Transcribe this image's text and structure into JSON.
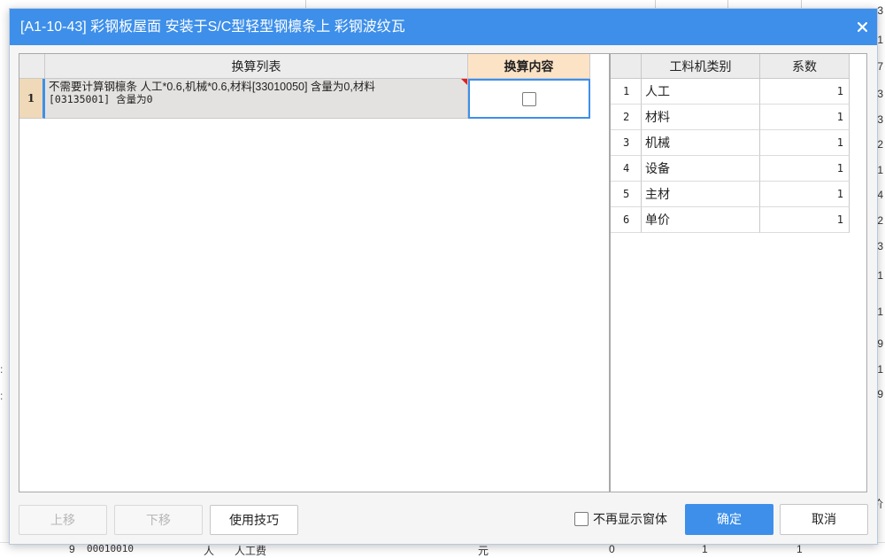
{
  "dialog": {
    "title": "[A1-10-43] 彩钢板屋面 安装于S/C型轻型钢檩条上 彩钢波纹瓦",
    "close_icon": "close-icon"
  },
  "left_table": {
    "headers": {
      "list": "换算列表",
      "content": "换算内容"
    },
    "rows": [
      {
        "num": "1",
        "text_line1": "不需要计算钢檩条 人工*0.6,机械*0.6,材料[33010050] 含量为0,材料",
        "text_line2": "[03135001] 含量为0",
        "checked": false
      }
    ]
  },
  "right_table": {
    "headers": {
      "type": "工料机类别",
      "coef": "系数"
    },
    "rows": [
      {
        "num": "1",
        "type": "人工",
        "coef": "1"
      },
      {
        "num": "2",
        "type": "材料",
        "coef": "1"
      },
      {
        "num": "3",
        "type": "机械",
        "coef": "1"
      },
      {
        "num": "4",
        "type": "设备",
        "coef": "1"
      },
      {
        "num": "5",
        "type": "主材",
        "coef": "1"
      },
      {
        "num": "6",
        "type": "单价",
        "coef": "1"
      }
    ]
  },
  "footer": {
    "move_up": "上移",
    "move_down": "下移",
    "tips": "使用技巧",
    "no_more_label": "不再显示窗体",
    "ok": "确定",
    "cancel": "取消"
  },
  "background": {
    "right_edge_digits": [
      "3",
      "1",
      "7",
      "3",
      "3",
      "2",
      "1",
      "4",
      "2",
      "3",
      "1",
      "1",
      "9",
      "1",
      "9",
      "价"
    ],
    "bottom_row": {
      "num": "9",
      "code": "00010010",
      "kind": "人",
      "name": "人工费",
      "unit": "元",
      "val1": "0",
      "val2": "1",
      "val3": "1"
    }
  }
}
